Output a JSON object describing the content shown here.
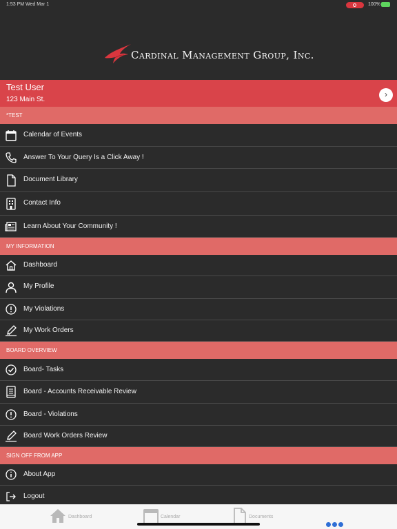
{
  "status_bar": {
    "time": "1:53 PM  Wed Mar 1",
    "battery": "100%"
  },
  "header": {
    "company": "Cardinal Management Group, Inc."
  },
  "user": {
    "name": "Test User",
    "address": "123 Main St."
  },
  "sections": [
    {
      "title": "*TEST",
      "items": [
        {
          "label": "Calendar of Events",
          "icon": "calendar-icon"
        },
        {
          "label": "Answer To Your Query Is a Click Away !",
          "icon": "phone-icon"
        },
        {
          "label": "Document Library",
          "icon": "document-icon"
        },
        {
          "label": "Contact Info",
          "icon": "building-icon"
        },
        {
          "label": "Learn About Your Community !",
          "icon": "newspaper-icon"
        }
      ]
    },
    {
      "title": "MY INFORMATION",
      "items": [
        {
          "label": "Dashboard",
          "icon": "home-icon"
        },
        {
          "label": "My Profile",
          "icon": "person-icon"
        },
        {
          "label": "My Violations",
          "icon": "alert-icon"
        },
        {
          "label": "My Work Orders",
          "icon": "pencil-icon"
        }
      ]
    },
    {
      "title": "BOARD OVERVIEW",
      "items": [
        {
          "label": "Board- Tasks",
          "icon": "check-circle-icon"
        },
        {
          "label": "Board - Accounts Receivable Review",
          "icon": "ledger-icon"
        },
        {
          "label": "Board - Violations",
          "icon": "alert-icon"
        },
        {
          "label": "Board Work Orders Review",
          "icon": "pencil-icon"
        }
      ]
    },
    {
      "title": "SIGN OFF FROM APP",
      "items": [
        {
          "label": "About App",
          "icon": "info-icon"
        },
        {
          "label": "Logout",
          "icon": "logout-icon"
        }
      ]
    }
  ],
  "tabbar": {
    "dashboard": "Dashboard",
    "calendar": "Calendar",
    "documents": "Documents"
  },
  "colors": {
    "section": "#e06a67",
    "user_bar": "#d9444a",
    "background": "#2b2b2b",
    "tab_active": "#2f6fd6"
  }
}
